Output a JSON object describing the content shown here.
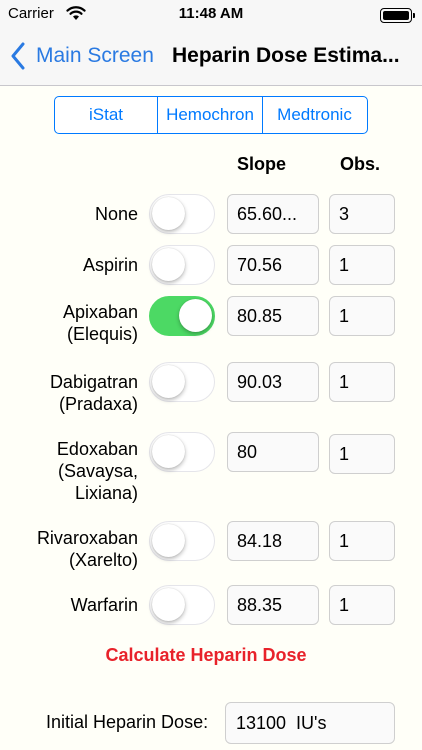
{
  "status_bar": {
    "carrier": "Carrier",
    "time": "11:48 AM"
  },
  "nav": {
    "back_label": "Main Screen",
    "title": "Heparin Dose Estima..."
  },
  "segments": [
    {
      "label": "iStat",
      "selected": true
    },
    {
      "label": "Hemochron",
      "selected": false
    },
    {
      "label": "Medtronic",
      "selected": false
    }
  ],
  "columns": {
    "slope": "Slope",
    "obs": "Obs."
  },
  "rows": [
    {
      "label_lines": [
        "None"
      ],
      "on": false,
      "slope": "65.60...",
      "obs": "3"
    },
    {
      "label_lines": [
        "Aspirin"
      ],
      "on": false,
      "slope": "70.56",
      "obs": "1"
    },
    {
      "label_lines": [
        "Apixaban",
        "(Elequis)"
      ],
      "on": true,
      "slope": "80.85",
      "obs": "1"
    },
    {
      "label_lines": [
        "Dabigatran",
        "(Pradaxa)"
      ],
      "on": false,
      "slope": "90.03",
      "obs": "1"
    },
    {
      "label_lines": [
        "Edoxaban",
        "(Savaysa,",
        "Lixiana)"
      ],
      "on": false,
      "slope": "80",
      "obs": "1"
    },
    {
      "label_lines": [
        "Rivaroxaban",
        "(Xarelto)"
      ],
      "on": false,
      "slope": "84.18",
      "obs": "1"
    },
    {
      "label_lines": [
        "Warfarin"
      ],
      "on": false,
      "slope": "88.35",
      "obs": "1"
    }
  ],
  "calculate_label": "Calculate Heparin Dose",
  "dose": {
    "label": "Initial Heparin Dose:",
    "value": "13100  IU's"
  },
  "colors": {
    "accent": "#007aff",
    "toggle_on": "#4cd964",
    "calculate": "#e8222a",
    "background": "#fffff8"
  }
}
